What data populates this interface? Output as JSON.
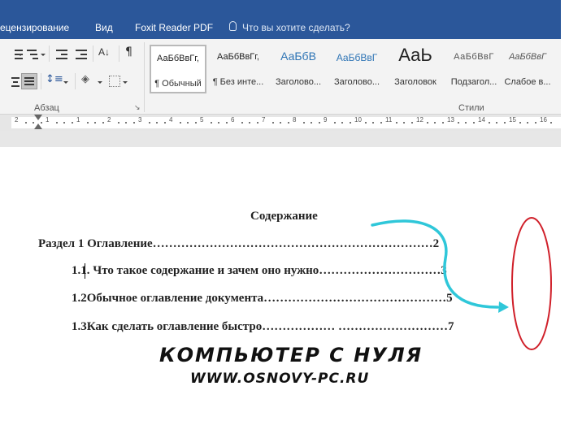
{
  "ribbon_tabs": {
    "review": "ецензирование",
    "view": "Вид",
    "foxit": "Foxit Reader PDF",
    "tell_me": "Что вы хотите сделать?"
  },
  "groups": {
    "paragraph": "Абзац",
    "styles": "Стили"
  },
  "styles_gallery": [
    {
      "sample": "АаБбВвГг,",
      "name": "¶ Обычный"
    },
    {
      "sample": "АаБбВвГг,",
      "name": "¶ Без инте..."
    },
    {
      "sample": "АаБбВ",
      "name": "Заголово..."
    },
    {
      "sample": "АаБбВвГ",
      "name": "Заголово..."
    },
    {
      "sample": "АаЬ",
      "name": "Заголовок"
    },
    {
      "sample": "АаБбВвГ",
      "name": "Подзагол..."
    },
    {
      "sample": "АаБбВвГ",
      "name": "Слабое в..."
    }
  ],
  "ruler_numbers": [
    "2",
    "1",
    "1",
    "2",
    "3",
    "4",
    "5",
    "6",
    "7",
    "8",
    "9",
    "10",
    "11",
    "12",
    "13",
    "14",
    "15",
    "16"
  ],
  "document": {
    "heading": "Содержание",
    "toc": [
      {
        "text": "Раздел 1 Оглавление……………………………………………………………2"
      },
      {
        "text": "1.1. Что такое содержание и зачем оно нужно…………………………3"
      },
      {
        "text": "1.2Обычное оглавление документа………………………………………5"
      },
      {
        "text": "1.3Как сделать оглавление быстро……………… ………………………7"
      }
    ]
  },
  "watermark": {
    "line1": "КОМПЬЮТЕР С НУЛЯ",
    "line2": "WWW.OSNOVY-PC.RU"
  },
  "colors": {
    "ribbon_blue": "#2b579a",
    "arrow_cyan": "#2fc7d9",
    "circle_red": "#d0202a"
  }
}
